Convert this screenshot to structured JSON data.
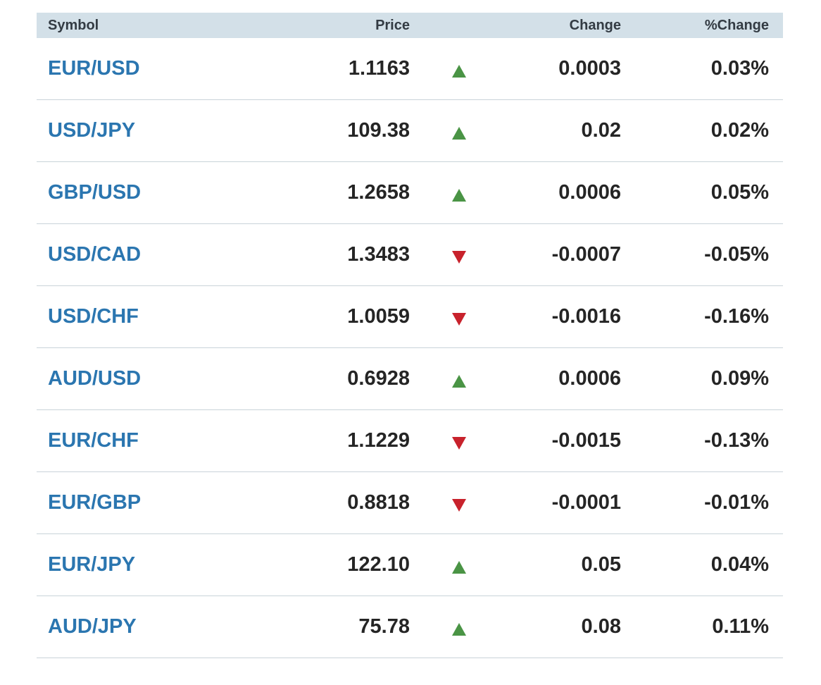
{
  "header": {
    "symbol": "Symbol",
    "price": "Price",
    "change": "Change",
    "pct_change": "%Change"
  },
  "colors": {
    "symbol_link": "#2b76b0",
    "up": "#4a9445",
    "down": "#c8222c",
    "header_bg": "#d3e0e8"
  },
  "rows": [
    {
      "symbol": "EUR/USD",
      "price": "1.1163",
      "direction": "up",
      "change": "0.0003",
      "pct": "0.03%"
    },
    {
      "symbol": "USD/JPY",
      "price": "109.38",
      "direction": "up",
      "change": "0.02",
      "pct": "0.02%"
    },
    {
      "symbol": "GBP/USD",
      "price": "1.2658",
      "direction": "up",
      "change": "0.0006",
      "pct": "0.05%"
    },
    {
      "symbol": "USD/CAD",
      "price": "1.3483",
      "direction": "down",
      "change": "-0.0007",
      "pct": "-0.05%"
    },
    {
      "symbol": "USD/CHF",
      "price": "1.0059",
      "direction": "down",
      "change": "-0.0016",
      "pct": "-0.16%"
    },
    {
      "symbol": "AUD/USD",
      "price": "0.6928",
      "direction": "up",
      "change": "0.0006",
      "pct": "0.09%"
    },
    {
      "symbol": "EUR/CHF",
      "price": "1.1229",
      "direction": "down",
      "change": "-0.0015",
      "pct": "-0.13%"
    },
    {
      "symbol": "EUR/GBP",
      "price": "0.8818",
      "direction": "down",
      "change": "-0.0001",
      "pct": "-0.01%"
    },
    {
      "symbol": "EUR/JPY",
      "price": "122.10",
      "direction": "up",
      "change": "0.05",
      "pct": "0.04%"
    },
    {
      "symbol": "AUD/JPY",
      "price": "75.78",
      "direction": "up",
      "change": "0.08",
      "pct": "0.11%"
    }
  ]
}
